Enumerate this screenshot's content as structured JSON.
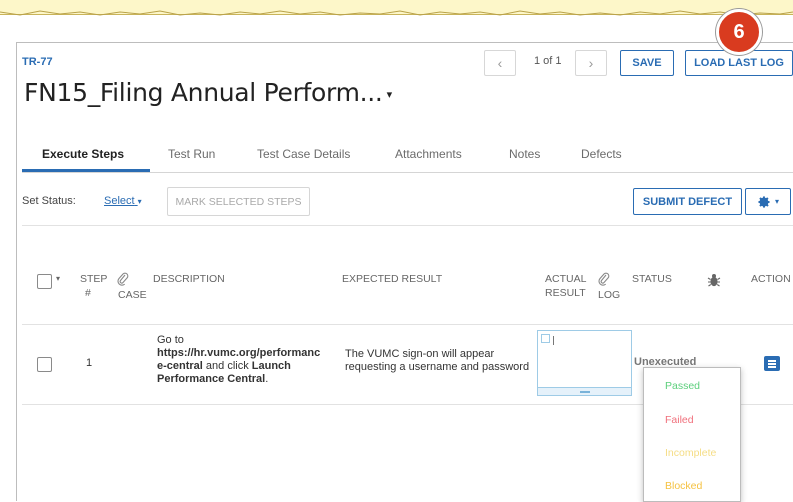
{
  "callout": {
    "number": "6"
  },
  "header": {
    "test_id": "TR-77",
    "title": "FN15_Filing Annual Perform...",
    "pager_text": "1 of 1",
    "save_label": "SAVE",
    "load_last_log_label": "LOAD LAST LOG"
  },
  "tabs": [
    {
      "label": "Execute Steps"
    },
    {
      "label": "Test Run"
    },
    {
      "label": "Test Case Details"
    },
    {
      "label": "Attachments"
    },
    {
      "label": "Notes"
    },
    {
      "label": "Defects"
    }
  ],
  "toolbar": {
    "set_status_label": "Set Status:",
    "select_label": "Select",
    "mark_selected_label": "MARK SELECTED STEPS",
    "submit_defect_label": "SUBMIT DEFECT"
  },
  "table": {
    "headers": {
      "step": "STEP",
      "step_hash": "#",
      "case": "CASE",
      "description": "DESCRIPTION",
      "expected": "EXPECTED RESULT",
      "actual_line1": "ACTUAL",
      "actual_line2": "RESULT",
      "log": "LOG",
      "status": "STATUS",
      "action": "ACTION"
    },
    "rows": [
      {
        "step": "1",
        "desc_pre": "Go to",
        "desc_url_1": "https://hr.vumc.org/performanc",
        "desc_url_2": "e-central",
        "desc_mid": " and click ",
        "desc_bold_1": "Launch",
        "desc_bold_2": "Performance Central",
        "desc_end": ".",
        "expected_line1": "The VUMC sign-on will appear",
        "expected_line2": "requesting a username and password",
        "status": "Unexecuted"
      }
    ]
  },
  "status_options": [
    {
      "label": "Passed",
      "color": "#5ccf7c"
    },
    {
      "label": "Failed",
      "color": "#f0707c"
    },
    {
      "label": "Incomplete",
      "color": "#f5dd85"
    },
    {
      "label": "Blocked",
      "color": "#f5c242"
    }
  ],
  "colors": {
    "accent": "#2a6cb3",
    "callout": "#d93b1f"
  }
}
